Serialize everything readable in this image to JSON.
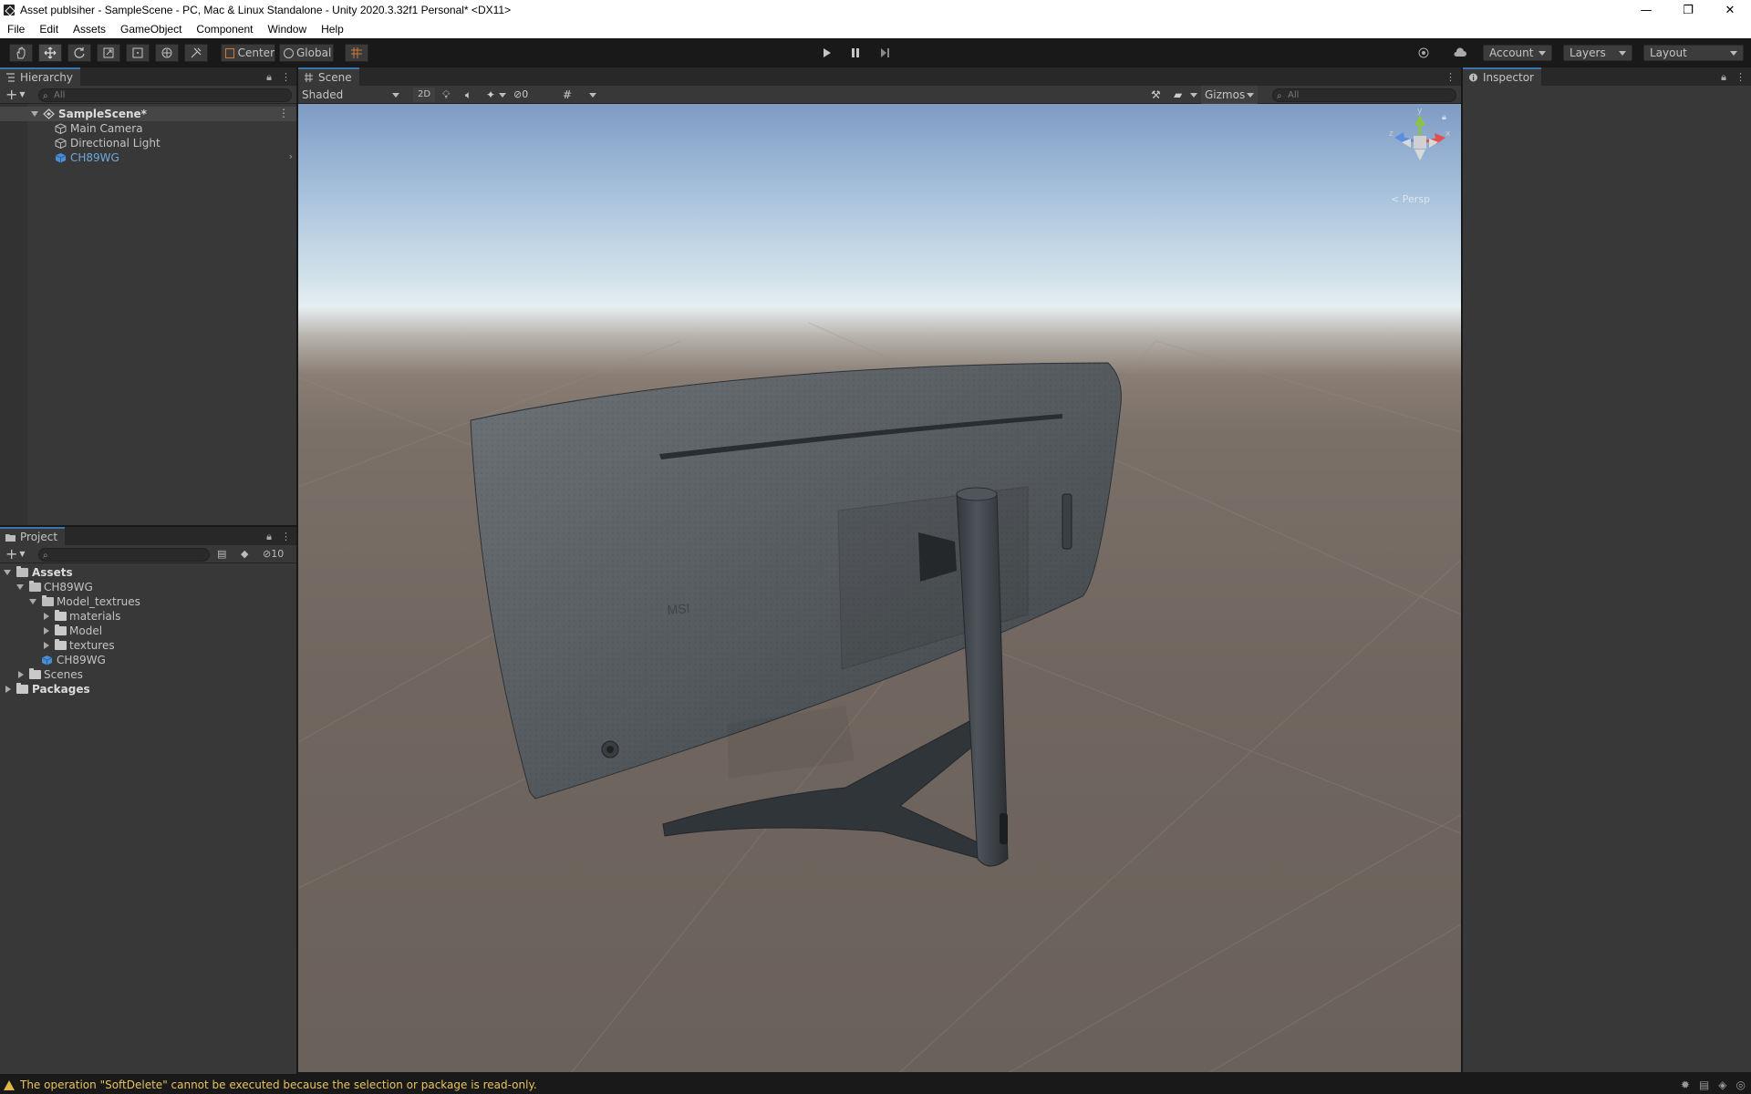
{
  "window": {
    "title": "Asset publsiher - SampleScene - PC, Mac & Linux Standalone - Unity 2020.3.32f1 Personal* <DX11>",
    "minimize": "—",
    "maximize": "❐",
    "close": "✕"
  },
  "menu": [
    "File",
    "Edit",
    "Assets",
    "GameObject",
    "Component",
    "Window",
    "Help"
  ],
  "toolbar": {
    "pivot_label": "Center",
    "space_label": "Global",
    "account_label": "Account",
    "layers_label": "Layers",
    "layout_label": "Layout"
  },
  "hierarchy": {
    "tab_label": "Hierarchy",
    "search_placeholder": "All",
    "scene_name": "SampleScene*",
    "items": [
      "Main Camera",
      "Directional Light",
      "CH89WG"
    ]
  },
  "project": {
    "tab_label": "Project",
    "hidden_count": "10",
    "tree": {
      "assets": "Assets",
      "ch89wg_folder": "CH89WG",
      "model_textures": "Model_textrues",
      "materials": "materials",
      "model": "Model",
      "textures": "textures",
      "ch89wg_prefab": "CH89WG",
      "scenes": "Scenes",
      "packages": "Packages"
    }
  },
  "scene": {
    "tab_label": "Scene",
    "shading_mode": "Shaded",
    "mode_2d": "2D",
    "hidden_count": "0",
    "gizmos_label": "Gizmos",
    "search_placeholder": "All",
    "persp_label": "< Persp",
    "monitor_logo": "MSI"
  },
  "inspector": {
    "tab_label": "Inspector"
  },
  "status": {
    "message": "The operation \"SoftDelete\" cannot be executed because the selection or package is read-only."
  },
  "colors": {
    "accent": "#3a72b0",
    "selected_text": "#6fa8dc",
    "warning": "#e8c35e"
  }
}
